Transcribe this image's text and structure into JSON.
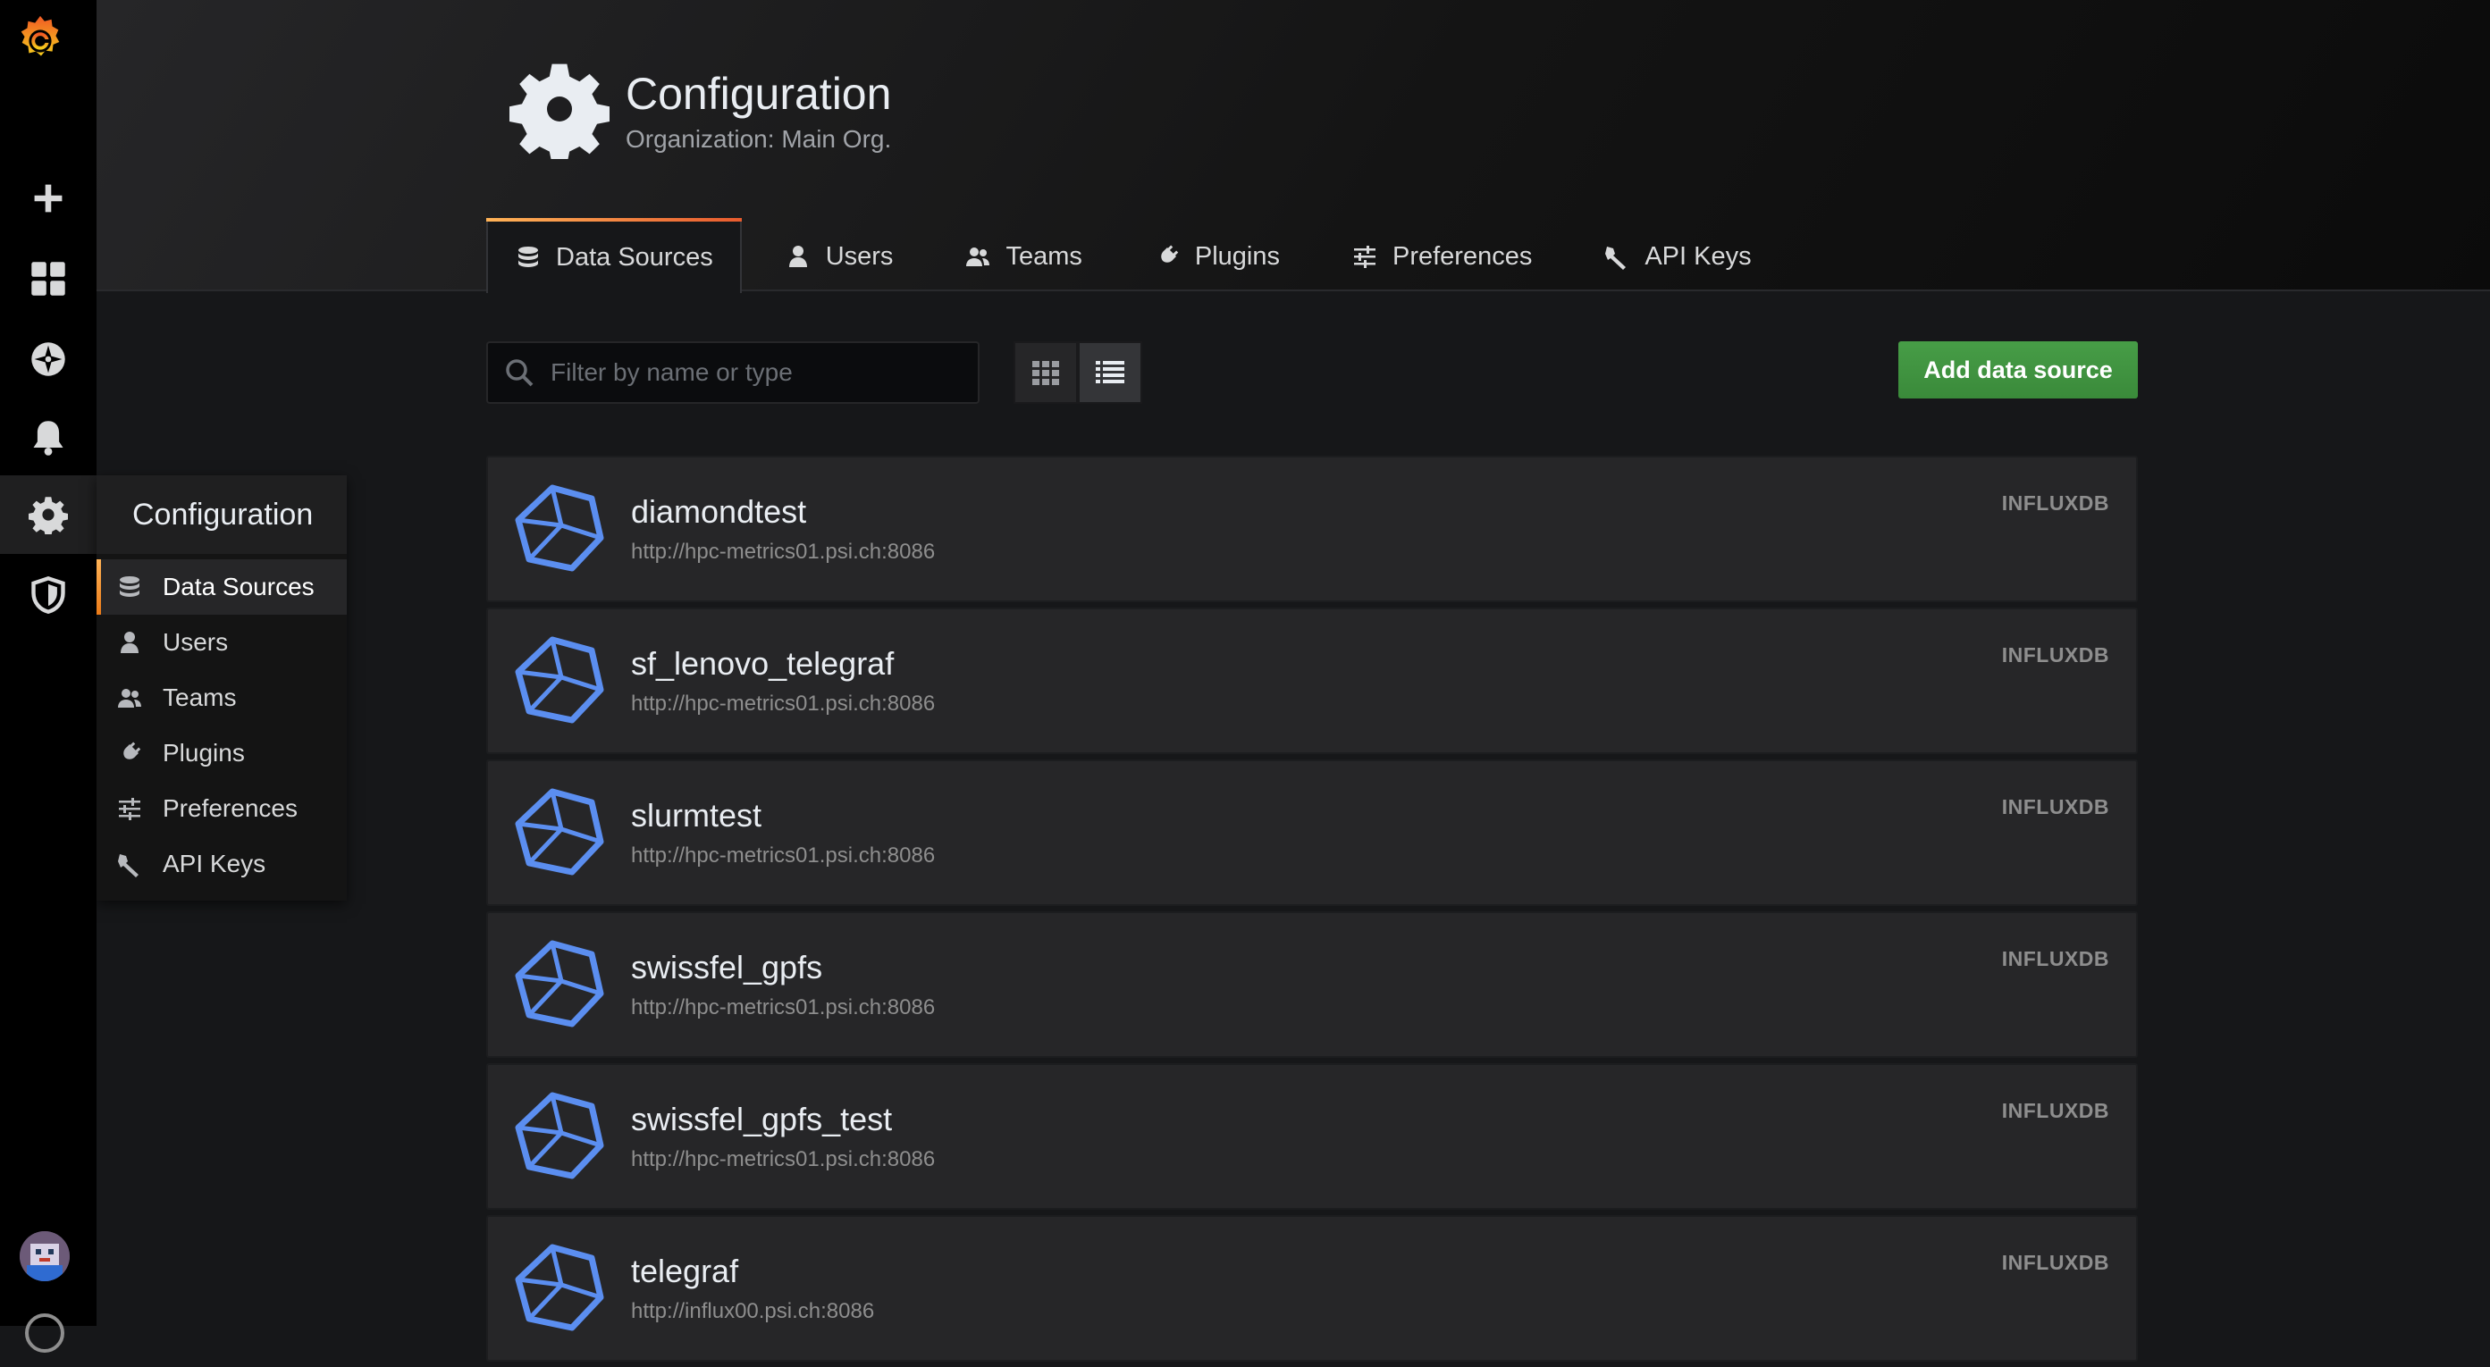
{
  "header": {
    "title": "Configuration",
    "subtitle": "Organization: Main Org."
  },
  "tabs": [
    {
      "label": "Data Sources",
      "icon": "database-icon",
      "active": true
    },
    {
      "label": "Users",
      "icon": "user-icon"
    },
    {
      "label": "Teams",
      "icon": "users-icon"
    },
    {
      "label": "Plugins",
      "icon": "plug-icon"
    },
    {
      "label": "Preferences",
      "icon": "sliders-icon"
    },
    {
      "label": "API Keys",
      "icon": "key-icon"
    }
  ],
  "flyout": {
    "title": "Configuration",
    "items": [
      {
        "label": "Data Sources",
        "icon": "database-icon",
        "active": true
      },
      {
        "label": "Users",
        "icon": "user-icon"
      },
      {
        "label": "Teams",
        "icon": "users-icon"
      },
      {
        "label": "Plugins",
        "icon": "plug-icon"
      },
      {
        "label": "Preferences",
        "icon": "sliders-icon"
      },
      {
        "label": "API Keys",
        "icon": "key-icon"
      }
    ]
  },
  "toolbar": {
    "search_placeholder": "Filter by name or type",
    "add_label": "Add data source"
  },
  "datasources": [
    {
      "name": "diamondtest",
      "url": "http://hpc-metrics01.psi.ch:8086",
      "type": "INFLUXDB"
    },
    {
      "name": "sf_lenovo_telegraf",
      "url": "http://hpc-metrics01.psi.ch:8086",
      "type": "INFLUXDB"
    },
    {
      "name": "slurmtest",
      "url": "http://hpc-metrics01.psi.ch:8086",
      "type": "INFLUXDB"
    },
    {
      "name": "swissfel_gpfs",
      "url": "http://hpc-metrics01.psi.ch:8086",
      "type": "INFLUXDB"
    },
    {
      "name": "swissfel_gpfs_test",
      "url": "http://hpc-metrics01.psi.ch:8086",
      "type": "INFLUXDB"
    },
    {
      "name": "telegraf",
      "url": "http://influx00.psi.ch:8086",
      "type": "INFLUXDB"
    }
  ],
  "colors": {
    "accent": "#f7941e",
    "add_button": "#3a8a3a",
    "influx_logo": "#5b8ef0"
  }
}
